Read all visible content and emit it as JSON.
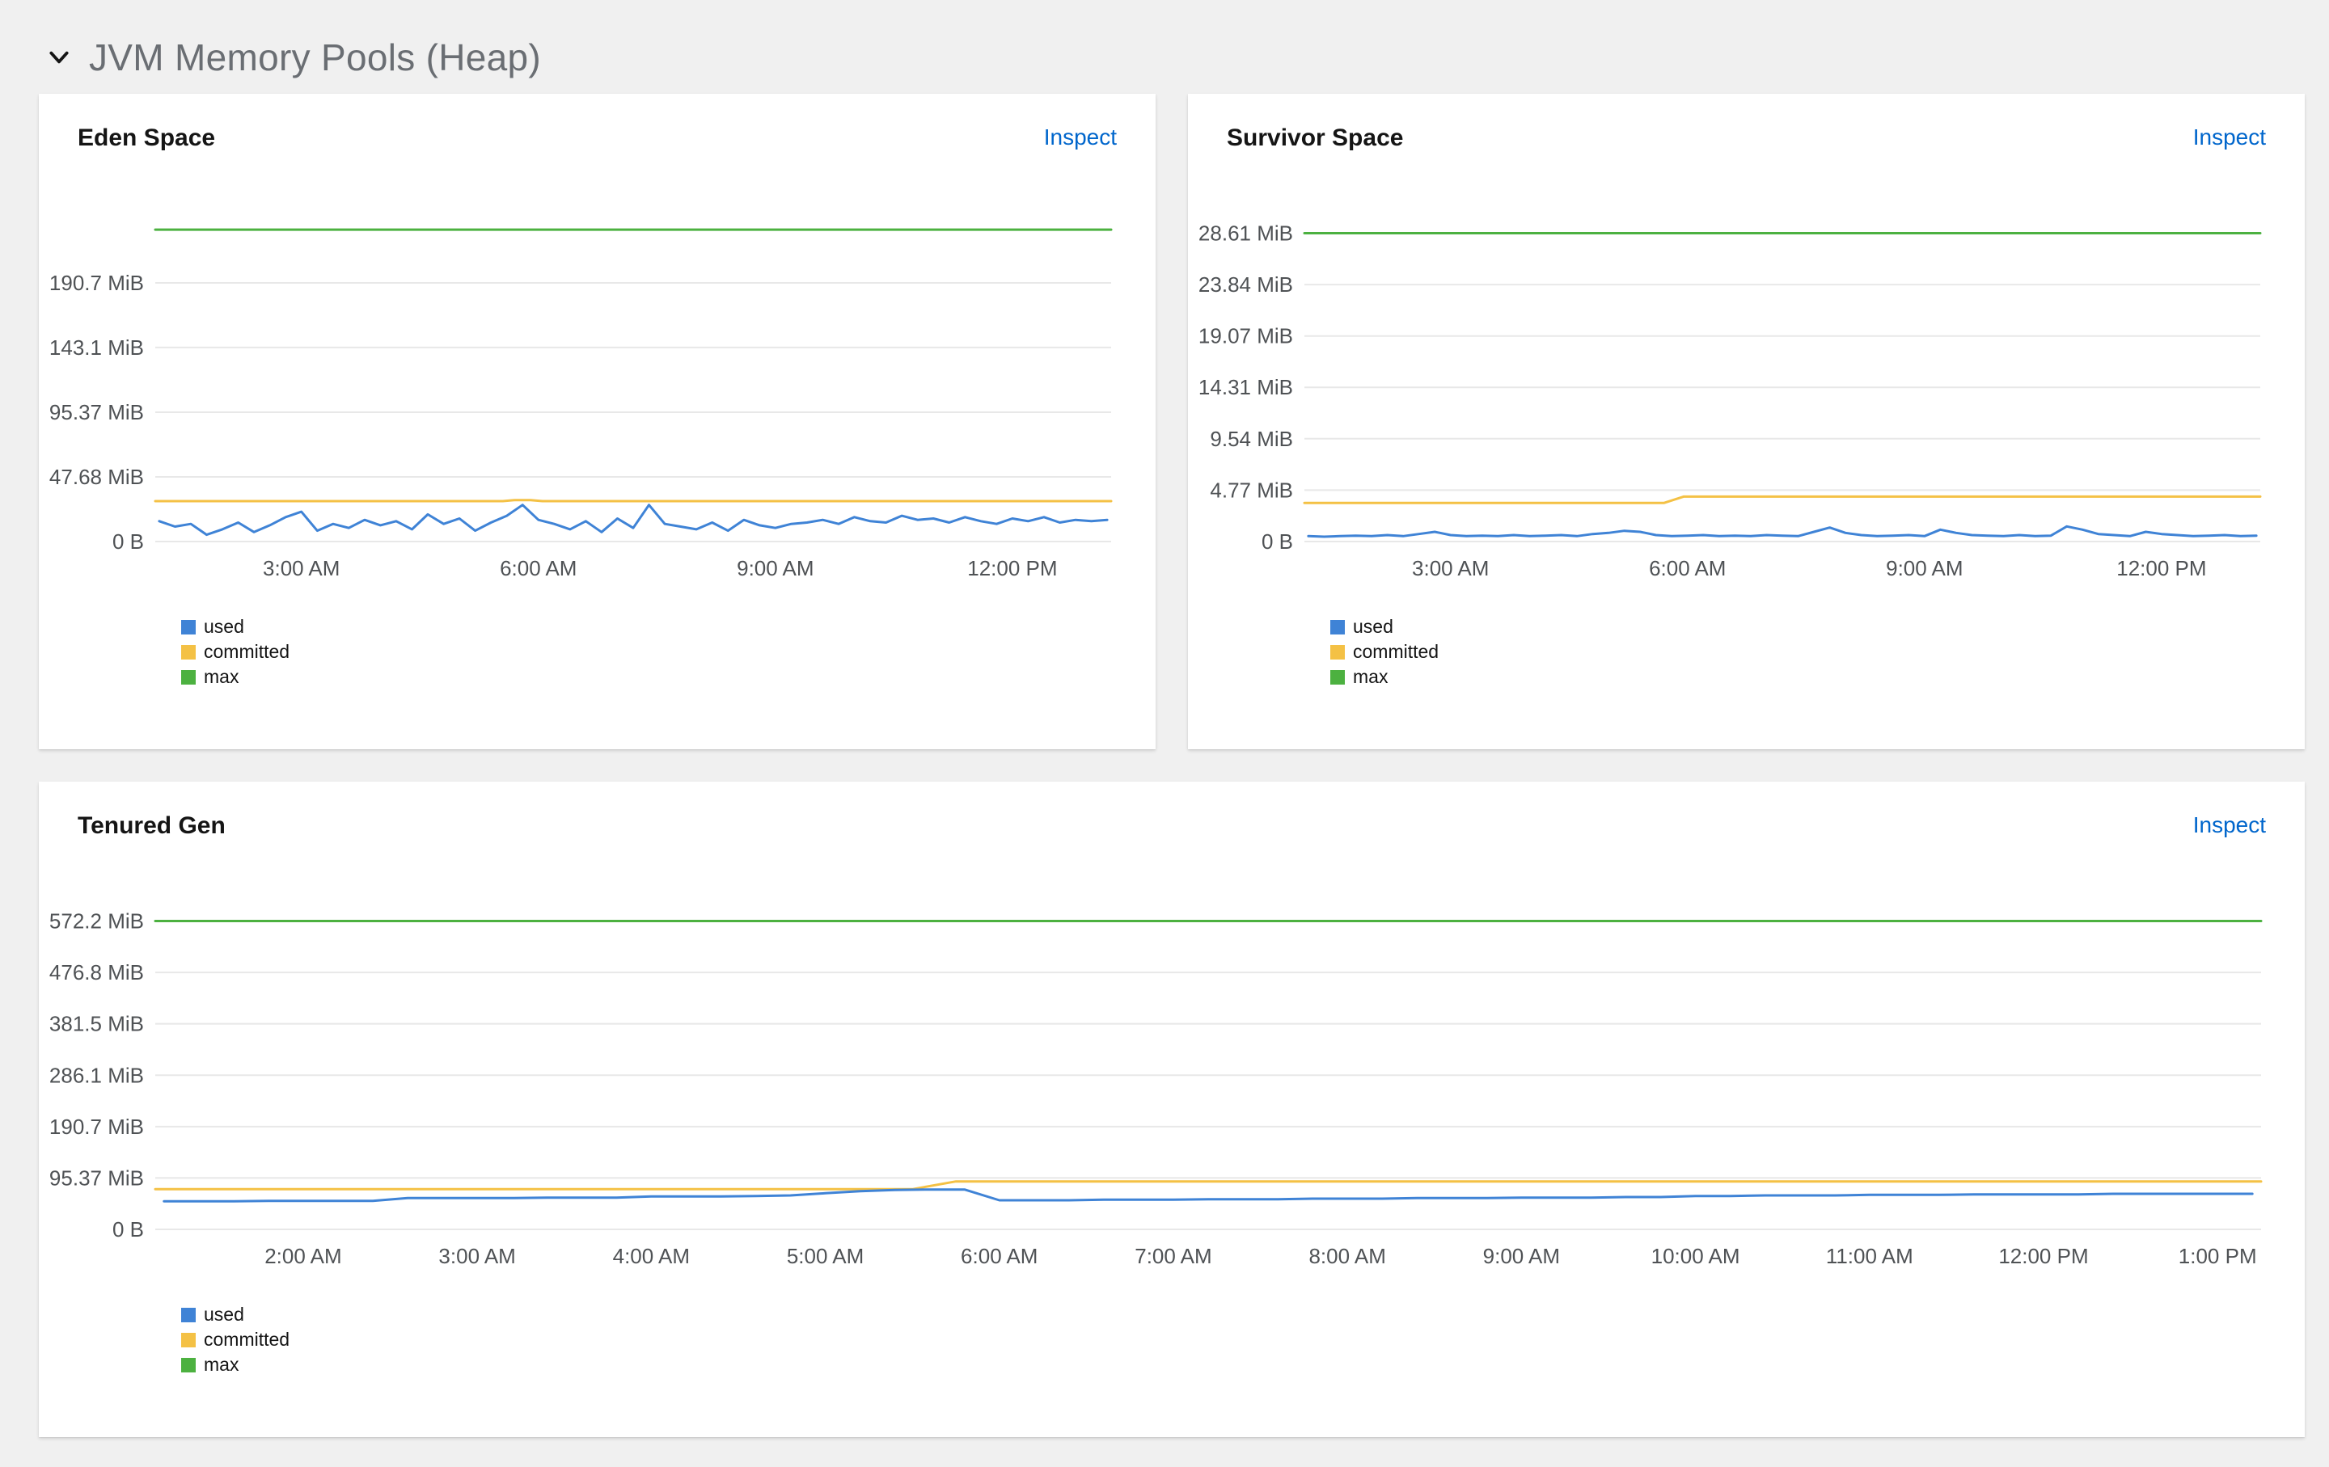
{
  "section": {
    "title": "JVM Memory Pools (Heap)"
  },
  "cards": [
    {
      "title": "Eden Space",
      "inspect_label": "Inspect"
    },
    {
      "title": "Survivor Space",
      "inspect_label": "Inspect"
    },
    {
      "title": "Tenured Gen",
      "inspect_label": "Inspect"
    }
  ],
  "colors": {
    "used": "#3f83d6",
    "committed": "#f4c145",
    "max": "#4cb140",
    "grid": "#e8e8e8",
    "axis_text": "#4f5255",
    "link": "#0066cc",
    "section_title": "#6a6e73",
    "card_background": "#ffffff",
    "page_background": "#f0f0f0"
  },
  "chart_data": [
    {
      "type": "line",
      "title": "Eden Space",
      "xlim": [
        1.15,
        13.25
      ],
      "ylim": [
        0,
        238.4
      ],
      "xticks": [
        {
          "v": 3,
          "label": "3:00 AM"
        },
        {
          "v": 6,
          "label": "6:00 AM"
        },
        {
          "v": 9,
          "label": "9:00 AM"
        },
        {
          "v": 12,
          "label": "12:00 PM"
        }
      ],
      "yticks": [
        {
          "v": 0,
          "label": "0 B"
        },
        {
          "v": 47.68,
          "label": "47.68 MiB"
        },
        {
          "v": 95.37,
          "label": "95.37 MiB"
        },
        {
          "v": 143.1,
          "label": "143.1 MiB"
        },
        {
          "v": 190.7,
          "label": "190.7 MiB"
        }
      ],
      "legend": [
        "used",
        "committed",
        "max"
      ],
      "series": [
        {
          "name": "used",
          "x_start": 1.2,
          "x_step": 0.2,
          "y": [
            15,
            11,
            13,
            5,
            9,
            14,
            7,
            12,
            18,
            22,
            8,
            13,
            10,
            16,
            12,
            15,
            9,
            20,
            13,
            17,
            8,
            14,
            19,
            27,
            16,
            13,
            9,
            15,
            7,
            17,
            10,
            27,
            13,
            11,
            9,
            14,
            8,
            16,
            12,
            10,
            13,
            14,
            16,
            13,
            18,
            15,
            14,
            19,
            16,
            17,
            14,
            18,
            15,
            13,
            17,
            15,
            18,
            14,
            16,
            15,
            16
          ]
        },
        {
          "name": "committed",
          "x": [
            1.15,
            5.55,
            5.7,
            5.9,
            6.05,
            13.25
          ],
          "y": [
            29.8,
            29.8,
            30.6,
            30.6,
            29.8,
            29.8
          ]
        },
        {
          "name": "max",
          "x": [
            1.15,
            13.25
          ],
          "y": [
            230,
            230
          ]
        }
      ]
    },
    {
      "type": "line",
      "title": "Survivor Space",
      "xlim": [
        1.15,
        13.25
      ],
      "ylim": [
        0,
        30
      ],
      "xticks": [
        {
          "v": 3,
          "label": "3:00 AM"
        },
        {
          "v": 6,
          "label": "6:00 AM"
        },
        {
          "v": 9,
          "label": "9:00 AM"
        },
        {
          "v": 12,
          "label": "12:00 PM"
        }
      ],
      "yticks": [
        {
          "v": 0,
          "label": "0 B"
        },
        {
          "v": 4.77,
          "label": "4.77 MiB"
        },
        {
          "v": 9.54,
          "label": "9.54 MiB"
        },
        {
          "v": 14.31,
          "label": "14.31 MiB"
        },
        {
          "v": 19.07,
          "label": "19.07 MiB"
        },
        {
          "v": 23.84,
          "label": "23.84 MiB"
        },
        {
          "v": 28.61,
          "label": "28.61 MiB"
        }
      ],
      "legend": [
        "used",
        "committed",
        "max"
      ],
      "series": [
        {
          "name": "used",
          "x_start": 1.2,
          "x_step": 0.2,
          "y": [
            0.5,
            0.45,
            0.5,
            0.55,
            0.5,
            0.6,
            0.5,
            0.7,
            0.9,
            0.6,
            0.5,
            0.55,
            0.5,
            0.6,
            0.5,
            0.55,
            0.6,
            0.5,
            0.7,
            0.8,
            1.0,
            0.9,
            0.6,
            0.5,
            0.55,
            0.6,
            0.5,
            0.55,
            0.5,
            0.6,
            0.55,
            0.5,
            0.9,
            1.3,
            0.8,
            0.6,
            0.5,
            0.55,
            0.6,
            0.5,
            1.1,
            0.8,
            0.6,
            0.55,
            0.5,
            0.6,
            0.5,
            0.55,
            1.4,
            1.1,
            0.7,
            0.6,
            0.5,
            0.9,
            0.7,
            0.6,
            0.5,
            0.55,
            0.6,
            0.5,
            0.55
          ]
        },
        {
          "name": "committed",
          "x": [
            1.15,
            5.7,
            5.95,
            13.25
          ],
          "y": [
            3.58,
            3.58,
            4.17,
            4.17
          ]
        },
        {
          "name": "max",
          "x": [
            1.15,
            13.25
          ],
          "y": [
            28.61,
            28.61
          ]
        }
      ]
    },
    {
      "type": "line",
      "title": "Tenured Gen",
      "xlim": [
        1.15,
        13.25
      ],
      "ylim": [
        0,
        600
      ],
      "xticks": [
        {
          "v": 2,
          "label": "2:00 AM"
        },
        {
          "v": 3,
          "label": "3:00 AM"
        },
        {
          "v": 4,
          "label": "4:00 AM"
        },
        {
          "v": 5,
          "label": "5:00 AM"
        },
        {
          "v": 6,
          "label": "6:00 AM"
        },
        {
          "v": 7,
          "label": "7:00 AM"
        },
        {
          "v": 8,
          "label": "8:00 AM"
        },
        {
          "v": 9,
          "label": "9:00 AM"
        },
        {
          "v": 10,
          "label": "10:00 AM"
        },
        {
          "v": 11,
          "label": "11:00 AM"
        },
        {
          "v": 12,
          "label": "12:00 PM"
        },
        {
          "v": 13,
          "label": "1:00 PM"
        }
      ],
      "yticks": [
        {
          "v": 0,
          "label": "0 B"
        },
        {
          "v": 95.37,
          "label": "95.37 MiB"
        },
        {
          "v": 190.7,
          "label": "190.7 MiB"
        },
        {
          "v": 286.1,
          "label": "286.1 MiB"
        },
        {
          "v": 381.5,
          "label": "381.5 MiB"
        },
        {
          "v": 476.8,
          "label": "476.8 MiB"
        },
        {
          "v": 572.2,
          "label": "572.2 MiB"
        }
      ],
      "legend": [
        "used",
        "committed",
        "max"
      ],
      "series": [
        {
          "name": "used",
          "x_start": 1.2,
          "x_step": 0.2,
          "y": [
            52,
            52,
            52,
            53,
            53,
            53,
            53,
            58,
            58,
            58,
            58,
            59,
            59,
            59,
            61,
            61,
            61,
            62,
            63,
            67,
            71,
            73,
            74,
            74,
            54,
            54,
            54,
            55,
            55,
            55,
            56,
            56,
            56,
            57,
            57,
            57,
            58,
            58,
            58,
            59,
            59,
            59,
            60,
            60,
            62,
            62,
            63,
            63,
            63,
            64,
            64,
            64,
            65,
            65,
            65,
            65,
            66,
            66,
            66,
            66,
            66
          ]
        },
        {
          "name": "committed",
          "x": [
            1.15,
            5.5,
            5.75,
            13.25
          ],
          "y": [
            74.5,
            74.5,
            89,
            89
          ]
        },
        {
          "name": "max",
          "x": [
            1.15,
            13.25
          ],
          "y": [
            572.2,
            572.2
          ]
        }
      ]
    }
  ]
}
